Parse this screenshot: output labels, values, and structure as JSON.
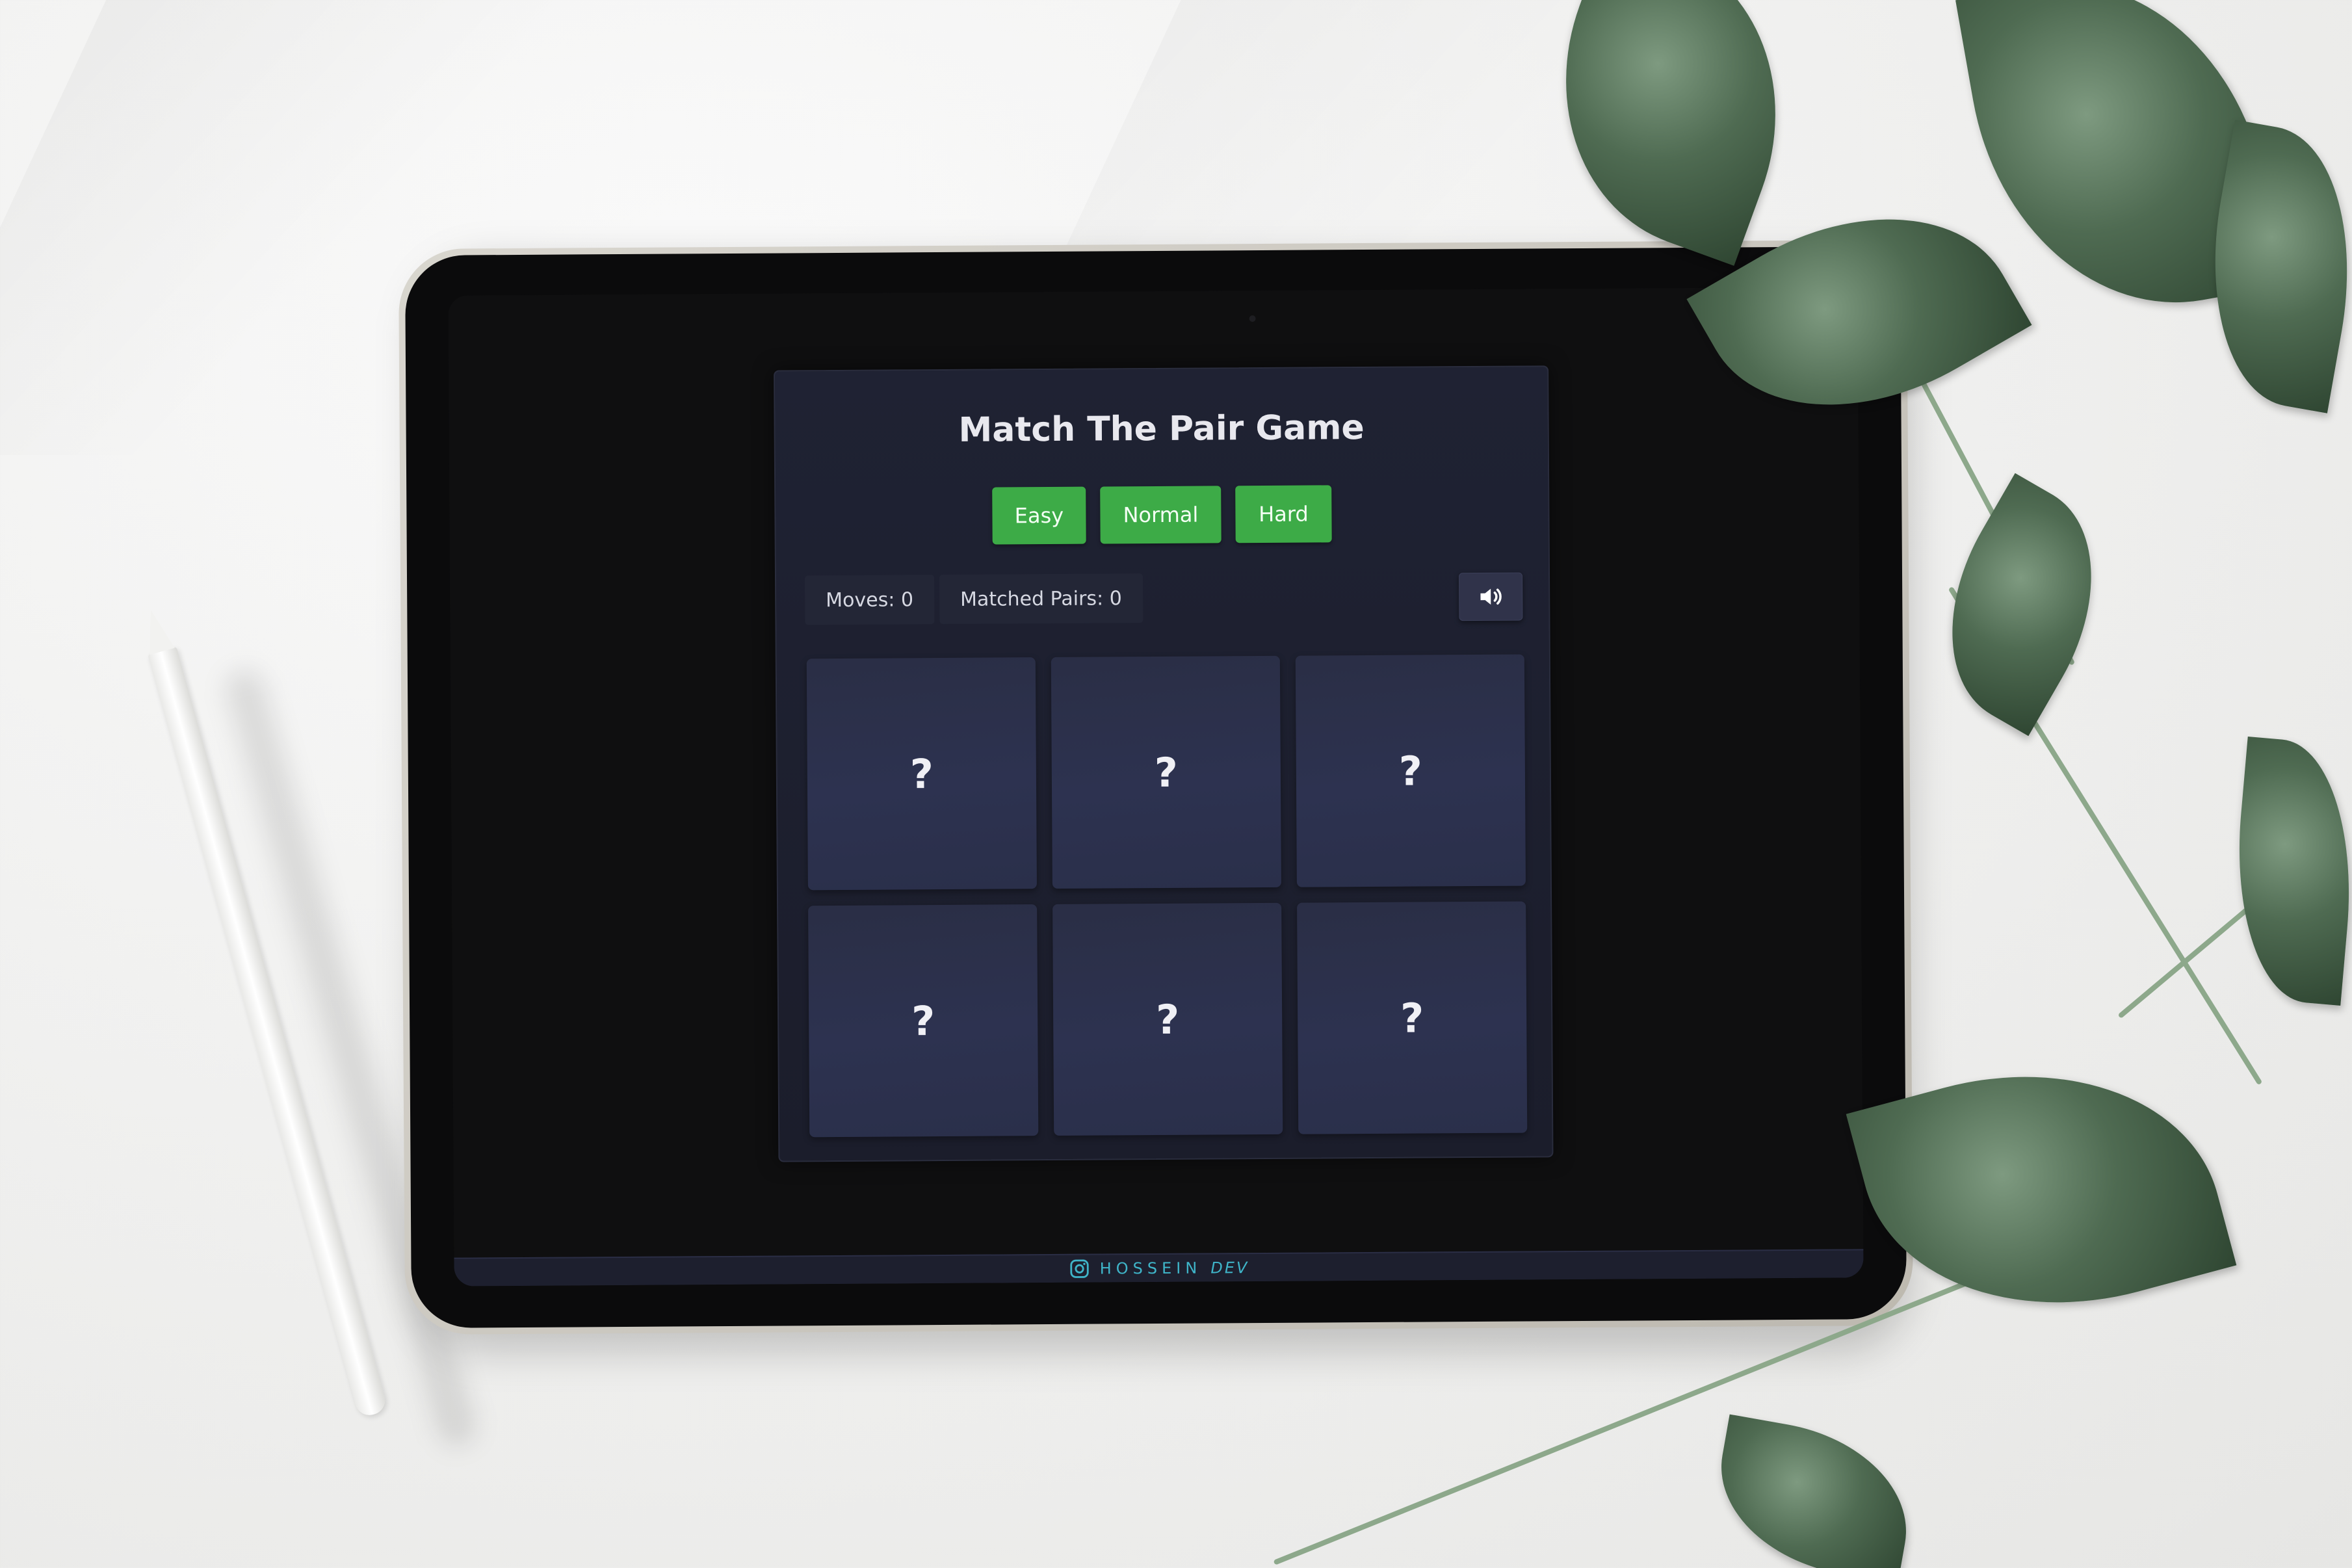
{
  "game": {
    "title": "Match The Pair Game",
    "levels": [
      "Easy",
      "Normal",
      "Hard"
    ],
    "stats": {
      "moves": "Moves: 0",
      "matched_pairs": "Matched Pairs: 0"
    },
    "sound_icon": "speaker-volume-icon",
    "cards": [
      "?",
      "?",
      "?",
      "?",
      "?",
      "?"
    ]
  },
  "footer": {
    "icon": "instagram-icon",
    "brand": "HOSSEIN",
    "brand_suffix": "DEV"
  },
  "colors": {
    "level_button": "#3dab47",
    "panel_bg": "#1f2233",
    "card_bg": "#2d3250",
    "brand": "#3fb5c9"
  }
}
